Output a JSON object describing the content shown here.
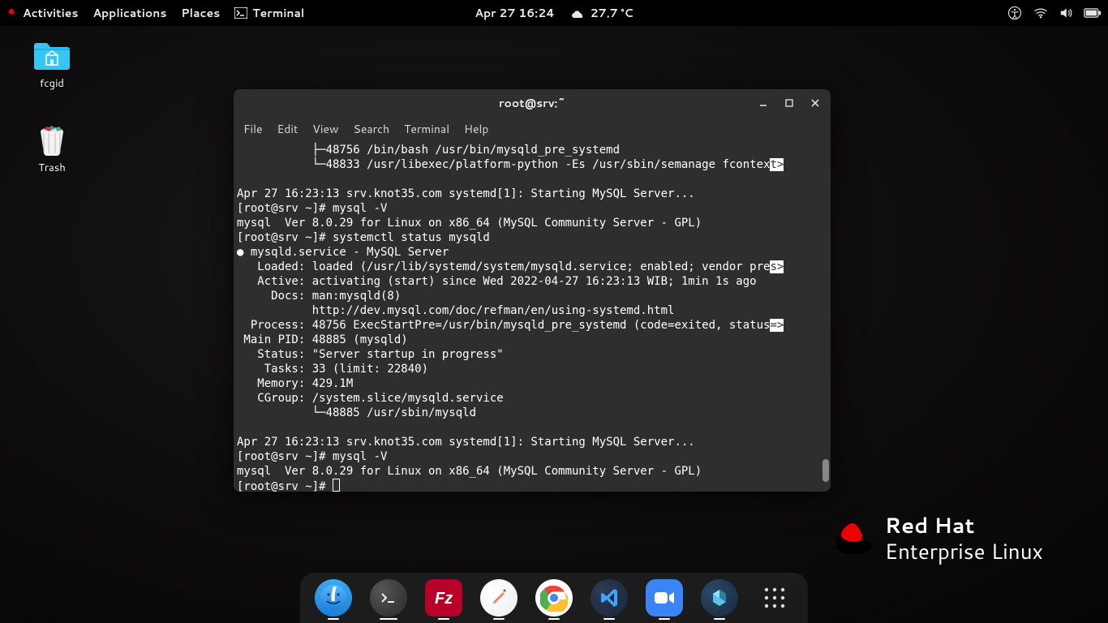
{
  "topbar": {
    "activities": "Activities",
    "applications": "Applications",
    "places": "Places",
    "terminal": "Terminal",
    "clock": "Apr 27  16:24",
    "weather": "27.7 °C"
  },
  "desktop": {
    "icon1": "fcgid",
    "icon2": "Trash"
  },
  "terminal": {
    "title": "root@srv:~",
    "menu": {
      "file": "File",
      "edit": "Edit",
      "view": "View",
      "search": "Search",
      "terminal": "Terminal",
      "help": "Help"
    },
    "lines": {
      "l1a": "           ├─48756 /bin/bash /usr/bin/mysqld_pre_systemd",
      "l1b_pre": "           └─48833 /usr/libexec/platform-python -Es /usr/sbin/semanage fcontex",
      "l1b_hl": "t>",
      "l2": "",
      "l3": "Apr 27 16:23:13 srv.knot35.com systemd[1]: Starting MySQL Server...",
      "l4": "[root@srv ~]# mysql -V",
      "l5": "mysql  Ver 8.0.29 for Linux on x86_64 (MySQL Community Server - GPL)",
      "l6": "[root@srv ~]# systemctl status mysqld",
      "l7": "● mysqld.service - MySQL Server",
      "l8_pre": "   Loaded: loaded (/usr/lib/systemd/system/mysqld.service; enabled; vendor pre",
      "l8_hl": "s>",
      "l9": "   Active: activating (start) since Wed 2022-04-27 16:23:13 WIB; 1min 1s ago",
      "l10": "     Docs: man:mysqld(8)",
      "l11": "           http://dev.mysql.com/doc/refman/en/using-systemd.html",
      "l12_pre": "  Process: 48756 ExecStartPre=/usr/bin/mysqld_pre_systemd (code=exited, status",
      "l12_hl": "=>",
      "l13": " Main PID: 48885 (mysqld)",
      "l14": "   Status: \"Server startup in progress\"",
      "l15": "    Tasks: 33 (limit: 22840)",
      "l16": "   Memory: 429.1M",
      "l17": "   CGroup: /system.slice/mysqld.service",
      "l18": "           └─48885 /usr/sbin/mysqld",
      "l19": "",
      "l20": "Apr 27 16:23:13 srv.knot35.com systemd[1]: Starting MySQL Server...",
      "l21": "[root@srv ~]# mysql -V",
      "l22": "mysql  Ver 8.0.29 for Linux on x86_64 (MySQL Community Server - GPL)",
      "l23": "[root@srv ~]# "
    }
  },
  "branding": {
    "line1": "Red Hat",
    "line2": "Enterprise Linux"
  }
}
